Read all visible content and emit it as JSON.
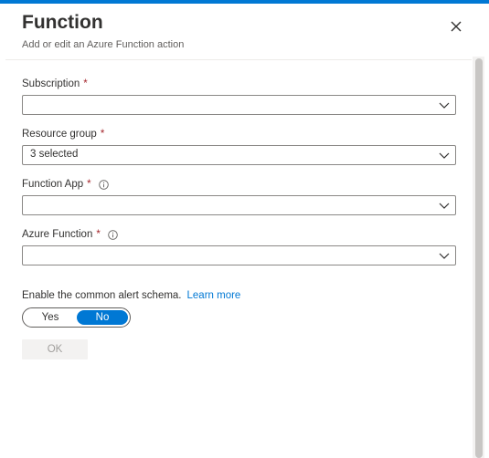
{
  "header": {
    "title": "Function",
    "subtitle": "Add or edit an Azure Function action"
  },
  "form": {
    "subscription": {
      "label": "Subscription",
      "required_mark": "*",
      "value": ""
    },
    "resource_group": {
      "label": "Resource group",
      "required_mark": "*",
      "value": "3 selected"
    },
    "function_app": {
      "label": "Function App",
      "required_mark": "*",
      "value": "",
      "info_icon": "info-icon"
    },
    "azure_function": {
      "label": "Azure Function",
      "required_mark": "*",
      "value": "",
      "info_icon": "info-icon"
    }
  },
  "schema": {
    "label": "Enable the common alert schema.",
    "link_text": "Learn more",
    "toggle": {
      "yes_label": "Yes",
      "no_label": "No",
      "selected": "No"
    }
  },
  "actions": {
    "ok_label": "OK",
    "ok_enabled": false
  },
  "colors": {
    "accent": "#0078d4",
    "required": "#a4262c",
    "disabled_bg": "#f3f2f1",
    "disabled_text": "#a19f9d"
  }
}
